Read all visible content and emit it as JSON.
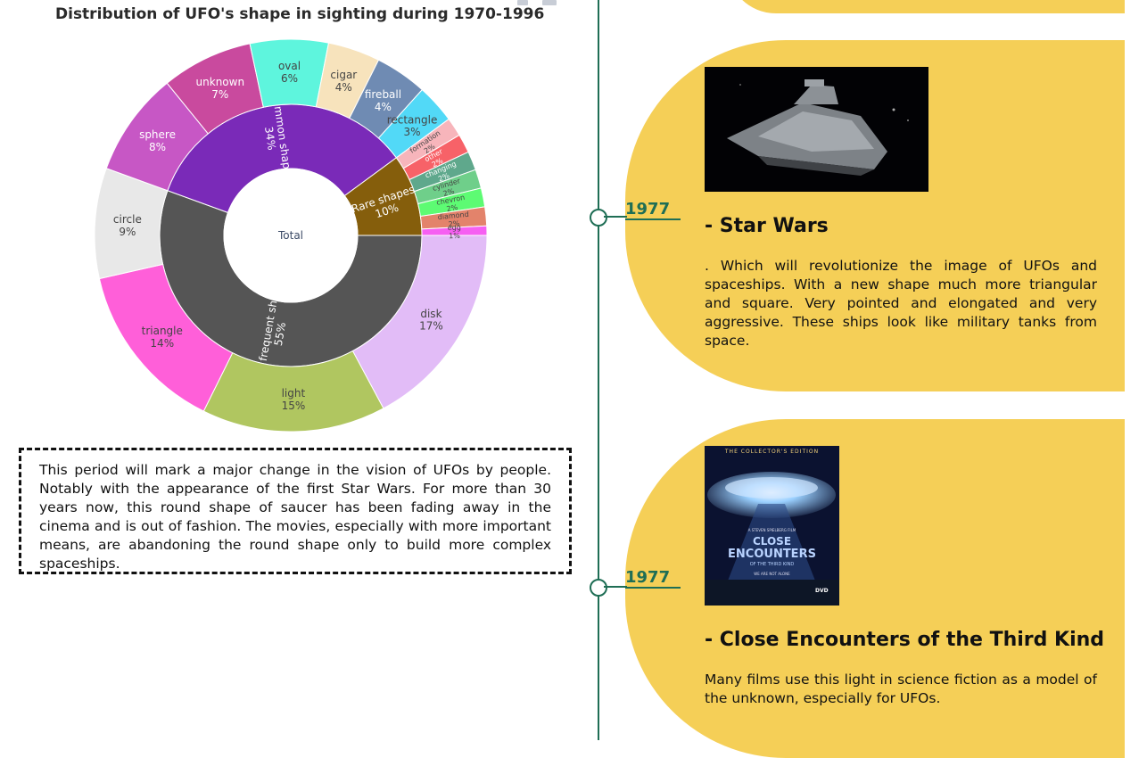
{
  "chart_data": {
    "type": "sunburst",
    "title": "Distribution of UFO's shape in sighting during 1970-1996",
    "root": "Total",
    "groups": [
      {
        "name": "High frequent shapes",
        "percent": "55%",
        "value": 55,
        "color": "#555555",
        "children": [
          {
            "name": "disk",
            "percent": "17%",
            "value": 17,
            "color": "#e2bcf7"
          },
          {
            "name": "light",
            "percent": "15%",
            "value": 15,
            "color": "#b0c660"
          },
          {
            "name": "triangle",
            "percent": "14%",
            "value": 14,
            "color": "#ff5fd9"
          },
          {
            "name": "circle",
            "percent": "9%",
            "value": 9,
            "color": "#e8e8e8"
          }
        ]
      },
      {
        "name": "Common shapes",
        "percent": "34%",
        "value": 34,
        "color": "#7a2ab8",
        "children": [
          {
            "name": "sphere",
            "percent": "8%",
            "value": 8,
            "color": "#c757c5"
          },
          {
            "name": "unknown",
            "percent": "7%",
            "value": 7,
            "color": "#c94a9e"
          },
          {
            "name": "oval",
            "percent": "6%",
            "value": 6,
            "color": "#5ef5dd"
          },
          {
            "name": "cigar",
            "percent": "4%",
            "value": 4,
            "color": "#f7e3bc"
          },
          {
            "name": "fireball",
            "percent": "4%",
            "value": 4,
            "color": "#6f8bb3"
          },
          {
            "name": "rectangle",
            "percent": "3%",
            "value": 3,
            "color": "#52d9f7"
          }
        ]
      },
      {
        "name": "Rare shapes",
        "percent": "10%",
        "value": 10,
        "color": "#855e0c",
        "children": [
          {
            "name": "formation",
            "percent": "2%",
            "value": 2,
            "color": "#f7b5bb"
          },
          {
            "name": "other",
            "percent": "2%",
            "value": 2,
            "color": "#f76268"
          },
          {
            "name": "changing",
            "percent": "2%",
            "value": 2,
            "color": "#5fa88c"
          },
          {
            "name": "cylinder",
            "percent": "2%",
            "value": 2,
            "color": "#6fcf8a"
          },
          {
            "name": "chevron",
            "percent": "2%",
            "value": 2,
            "color": "#5dfb73"
          },
          {
            "name": "diamond",
            "percent": "2%",
            "value": 2,
            "color": "#e3836b"
          },
          {
            "name": "egg",
            "percent": "1%",
            "value": 1,
            "color": "#f65ff2"
          }
        ]
      }
    ]
  },
  "note": {
    "text": "This period will mark a major change in the vision of UFOs by people. Notably with the appearance of the first Star Wars. For more than 30 years now, this round shape of saucer has been fading away in the cinema and is out of fashion. The movies, especially with more important means, are abandoning the round shape only to build more complex spaceships."
  },
  "timeline": {
    "line_color": "#1f6e55",
    "card_color": "#f5cf57",
    "entries": [
      {
        "year": "1977",
        "title": "- Star Wars",
        "text": ". Which will revolutionize the image of UFOs and spaceships. With a new shape much more triangular and square. Very pointed and elongated and very aggressive. These ships look like military tanks from space.",
        "image": "star-destroyer-image"
      },
      {
        "year": "1977",
        "title": "- Close Encounters of the Third Kind",
        "text": "Many films use this light in science fiction as a model of the unknown, especially for UFOs.",
        "image": "close-encounters-poster-image",
        "poster": {
          "top": "THE COLLECTOR'S EDITION",
          "credit": "A STEVEN SPIELBERG FILM",
          "line1": "CLOSE",
          "line2": "ENCOUNTERS",
          "line3": "OF THE THIRD KIND",
          "tagline": "WE ARE NOT ALONE",
          "badge": "DVD"
        }
      }
    ]
  }
}
